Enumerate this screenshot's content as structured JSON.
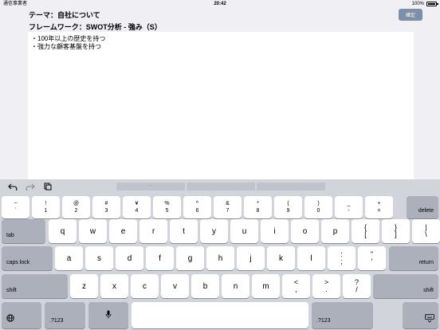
{
  "status": {
    "carrier": "通信事業者",
    "time": "20:42",
    "battery": "100%"
  },
  "header": {
    "theme": "テーマ：自社について",
    "framework": "フレームワーク：SWOT分析 - 強み（S）",
    "confirm_label": "確定"
  },
  "editor": {
    "lines": [
      "・100年以上の歴史を持つ",
      "・強力な顧客基盤を持つ"
    ]
  },
  "keyboard": {
    "row1": [
      {
        "top": "~",
        "bottom": "`"
      },
      {
        "top": "!",
        "bottom": "1"
      },
      {
        "top": "@",
        "bottom": "2"
      },
      {
        "top": "#",
        "bottom": "3"
      },
      {
        "top": "¥",
        "bottom": "4"
      },
      {
        "top": "%",
        "bottom": "5"
      },
      {
        "top": "^",
        "bottom": "6"
      },
      {
        "top": "&",
        "bottom": "7"
      },
      {
        "top": "*",
        "bottom": "8"
      },
      {
        "top": "(",
        "bottom": "9"
      },
      {
        "top": ")",
        "bottom": "0"
      },
      {
        "top": "_",
        "bottom": "-"
      },
      {
        "top": "+",
        "bottom": "="
      }
    ],
    "delete_label": "delete",
    "tab_label": "tab",
    "row2": [
      "q",
      "w",
      "e",
      "r",
      "t",
      "y",
      "u",
      "i",
      "o",
      "p"
    ],
    "row2_extra": [
      {
        "top": "{",
        "bottom": "["
      },
      {
        "top": "}",
        "bottom": "]"
      },
      {
        "top": "|",
        "bottom": "\\"
      }
    ],
    "caps_label": "caps lock",
    "row3": [
      "a",
      "s",
      "d",
      "f",
      "g",
      "h",
      "j",
      "k",
      "l"
    ],
    "row3_extra": [
      {
        "top": ":",
        "bottom": ";"
      },
      {
        "top": "\"",
        "bottom": "'"
      }
    ],
    "return_label": "return",
    "shift_label": "shift",
    "row4": [
      "z",
      "x",
      "c",
      "v",
      "b",
      "n",
      "m"
    ],
    "row4_extra": [
      {
        "top": "<",
        "bottom": ","
      },
      {
        "top": ">",
        "bottom": "."
      },
      {
        "top": "?",
        "bottom": "/"
      }
    ],
    "numbers_label": ".?123",
    "space_label": ""
  }
}
